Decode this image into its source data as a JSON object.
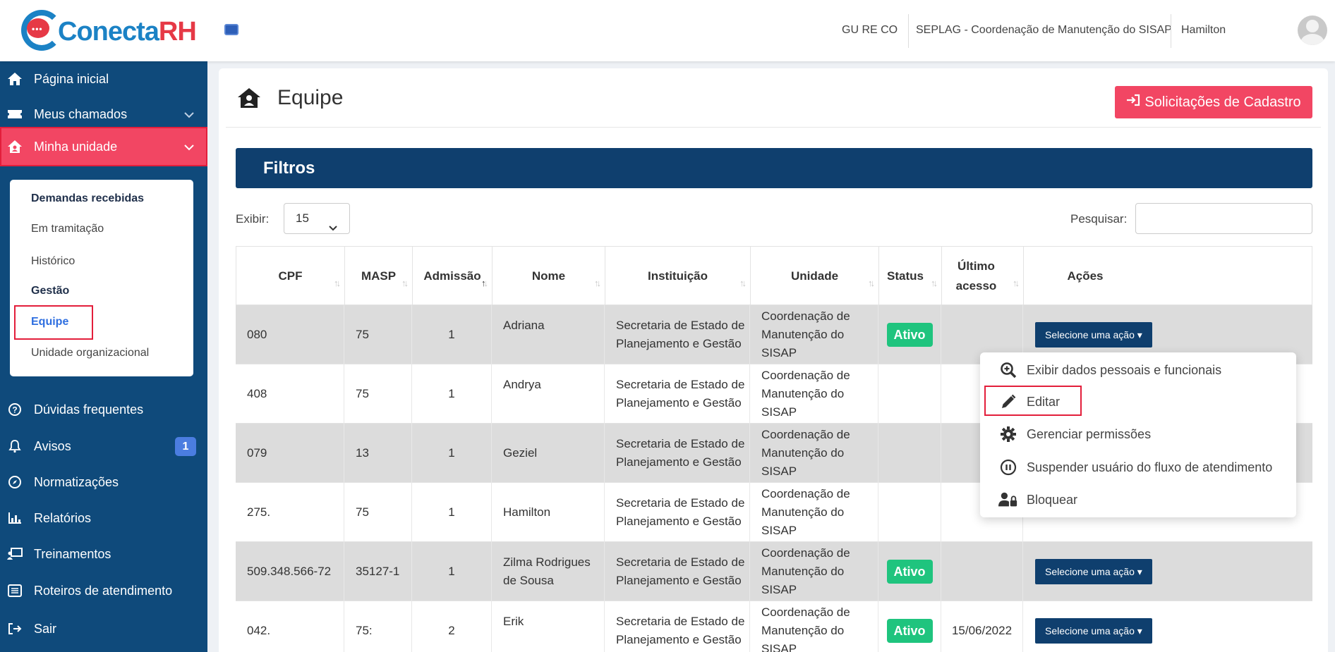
{
  "header": {
    "logo_main": "Conecta",
    "logo_rh": "RH",
    "logo_dots": "•••",
    "profile_short": "GU RE CO",
    "org": "SEPLAG - Coordenação de Manutenção do SISAP",
    "user": "Hamilton"
  },
  "sidebar": {
    "items": [
      {
        "label": "Página inicial",
        "icon": "home-icon"
      },
      {
        "label": "Meus chamados",
        "icon": "ticket-icon"
      },
      {
        "label": "Minha unidade",
        "icon": "house-user-icon"
      },
      {
        "label": "Dúvidas frequentes",
        "icon": "question-circle-icon"
      },
      {
        "label": "Avisos",
        "icon": "bell-icon",
        "badge": "1"
      },
      {
        "label": "Normatizações",
        "icon": "compass-icon"
      },
      {
        "label": "Relatórios",
        "icon": "chart-icon"
      },
      {
        "label": "Treinamentos",
        "icon": "chalkboard-icon"
      },
      {
        "label": "Roteiros de atendimento",
        "icon": "list-icon"
      },
      {
        "label": "Sair",
        "icon": "sign-out-icon"
      }
    ],
    "submenu": [
      {
        "label": "Demandas recebidas"
      },
      {
        "label": "Em tramitação"
      },
      {
        "label": "Histórico"
      },
      {
        "label": "Gestão"
      },
      {
        "label": "Equipe"
      },
      {
        "label": "Unidade organizacional"
      }
    ]
  },
  "main": {
    "title": "Equipe",
    "solicitacoes_label": "Solicitações de Cadastro",
    "filtros_label": "Filtros",
    "exibir_label": "Exibir:",
    "exibir_value": "15",
    "pesquisar_label": "Pesquisar:"
  },
  "table": {
    "columns": [
      "CPF",
      "MASP",
      "Admissão",
      "Nome",
      "Instituição",
      "Unidade",
      "Status",
      "Último acesso",
      "Ações"
    ],
    "rows": [
      {
        "cpf": "080",
        "masp": "75",
        "adm": "1",
        "nome": "Adriana",
        "inst": "Secretaria de Estado de Planejamento e Gestão",
        "unid": "Coordenação de Manutenção do SISAP",
        "status": "Ativo",
        "acesso": "",
        "acao": "Selecione uma ação"
      },
      {
        "cpf": "408",
        "masp": "75",
        "adm": "1",
        "nome": "Andrya",
        "inst": "Secretaria de Estado de Planejamento e Gestão",
        "unid": "Coordenação de Manutenção do SISAP",
        "status": "",
        "acesso": "",
        "acao": ""
      },
      {
        "cpf": "079",
        "masp": "13",
        "adm": "1",
        "nome": "Geziel",
        "inst": "Secretaria de Estado de Planejamento e Gestão",
        "unid": "Coordenação de Manutenção do SISAP",
        "status": "",
        "acesso": "",
        "acao": ""
      },
      {
        "cpf": "275.",
        "masp": "75",
        "adm": "1",
        "nome": "Hamilton",
        "inst": "Secretaria de Estado de Planejamento e Gestão",
        "unid": "Coordenação de Manutenção do SISAP",
        "status": "",
        "acesso": "",
        "acao": ""
      },
      {
        "cpf": "509.348.566-72",
        "masp": "35127-1",
        "adm": "1",
        "nome": "Zilma Rodrigues de Sousa",
        "inst": "Secretaria de Estado de Planejamento e Gestão",
        "unid": "Coordenação de Manutenção do SISAP",
        "status": "Ativo",
        "acesso": "",
        "acao": "Selecione uma ação"
      },
      {
        "cpf": "042.",
        "masp": "75:",
        "adm": "2",
        "nome": "Erik",
        "inst": "Secretaria de Estado de Planejamento e Gestão",
        "unid": "Coordenação de Manutenção do SISAP",
        "status": "Ativo",
        "acesso": "15/06/2022",
        "acao": "Selecione uma ação"
      }
    ]
  },
  "dropdown": {
    "items": [
      {
        "label": "Exibir dados pessoais e funcionais",
        "icon": "search-plus-icon"
      },
      {
        "label": "Editar",
        "icon": "pencil-icon"
      },
      {
        "label": "Gerenciar permissões",
        "icon": "gear-icon"
      },
      {
        "label": "Suspender usuário do fluxo de atendimento",
        "icon": "pause-circle-icon"
      },
      {
        "label": "Bloquear",
        "icon": "user-lock-icon"
      }
    ]
  },
  "colors": {
    "sidebar": "#0f4a7b",
    "accent_red": "#f24663",
    "navy": "#0f3f6e",
    "status_green": "#1fc47e"
  }
}
